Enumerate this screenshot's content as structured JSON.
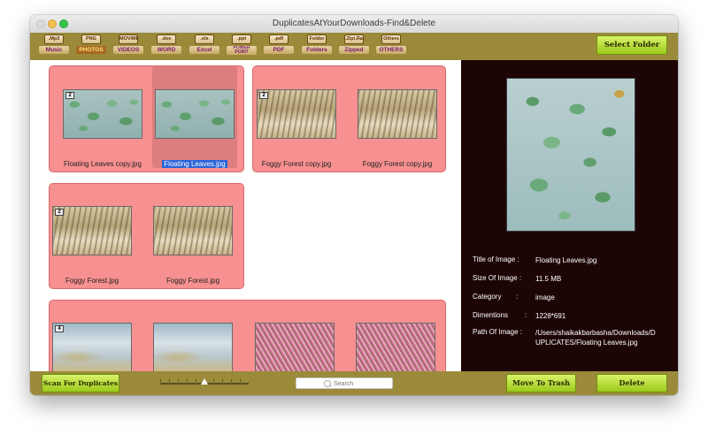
{
  "window": {
    "title": "DuplicatesAtYourDownloads-Find&Delete"
  },
  "toolbar": {
    "categories": [
      {
        "icon_text": ".Mp3",
        "label": "Music"
      },
      {
        "icon_text": "PNG",
        "label": "PHOTOS"
      },
      {
        "icon_text": "MOV/MP4",
        "label": "VIDEOS"
      },
      {
        "icon_text": ".doc",
        "label": "WORD"
      },
      {
        "icon_text": ".xls",
        "label": "Excel"
      },
      {
        "icon_text": ".ppt",
        "label": "POWER POINT"
      },
      {
        "icon_text": ".pdf",
        "label": "PDF"
      },
      {
        "icon_text": "Folder",
        "label": "Folders"
      },
      {
        "icon_text": ".Zip/.Rar",
        "label": "Zipped"
      },
      {
        "icon_text": "Others",
        "label": "OTHERS"
      }
    ],
    "selected_category": "PHOTOS",
    "select_folder_label": "Select Folder"
  },
  "groups": [
    {
      "count": "2",
      "items": [
        {
          "name": "Floating Leaves copy.jpg",
          "image": "leaves-icon"
        },
        {
          "name": "Floating Leaves.jpg",
          "image": "leaves-icon",
          "selected": true
        }
      ]
    },
    {
      "count": "2",
      "items": [
        {
          "name": "Foggy Forest copy.jpg",
          "image": "forest-icon"
        },
        {
          "name": "Foggy Forest copy.jpg",
          "image": "forest-icon"
        }
      ]
    },
    {
      "count": "2",
      "items": [
        {
          "name": "Foggy Forest.jpg",
          "image": "forest-icon"
        },
        {
          "name": "Foggy Forest.jpg",
          "image": "forest-icon"
        }
      ]
    },
    {
      "count": "4",
      "items": [
        {
          "name": "",
          "image": "mist-icon"
        },
        {
          "name": "",
          "image": "mist-icon"
        },
        {
          "name": "",
          "image": "grass-icon"
        },
        {
          "name": "",
          "image": "grass-icon"
        }
      ]
    }
  ],
  "details": {
    "title_label": "Title of Image :",
    "title_value": "Floating Leaves.jpg",
    "size_label": "Size Of Image :",
    "size_value": "11.5 MB",
    "category_label": "Category",
    "category_value": "image",
    "dimensions_label": "Dimentions",
    "dimensions_value": "1228*691",
    "path_label": "Path Of Image :",
    "path_value": "/Users/shaikakbarbasha/Downloads/DUPLICATES/Floating Leaves.jpg"
  },
  "bottombar": {
    "scan_label": "Scan For Duplicates",
    "search_placeholder": "Search",
    "trash_label": "Move To Trash",
    "delete_label": "Delete",
    "slider_value": 0.5
  },
  "colors": {
    "bar": "#9a8a3a",
    "group_bg": "#f79090",
    "panel_bg": "#1e0505",
    "button_green": "#b5de36"
  }
}
